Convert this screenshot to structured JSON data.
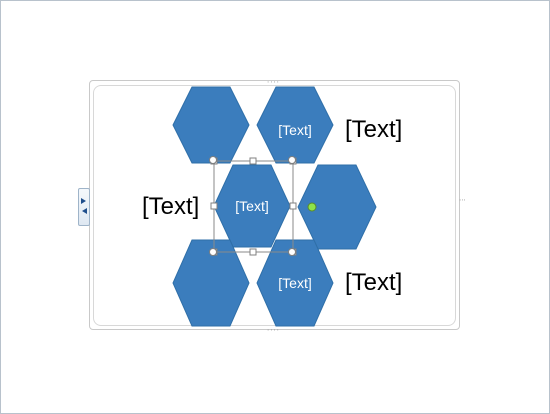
{
  "diagram": {
    "hexagons": [
      {
        "label": ""
      },
      {
        "label": "[Text]"
      },
      {
        "label": "[Text]"
      },
      {
        "label": ""
      },
      {
        "label": ""
      },
      {
        "label": "[Text]"
      }
    ],
    "callouts": {
      "top_right": "[Text]",
      "middle_left": "[Text]",
      "bottom_right": "[Text]"
    },
    "colors": {
      "hex_fill": "#3b7dbd",
      "hex_text": "#ffffff",
      "rotation_handle": "#8ee24a"
    }
  },
  "frame": {
    "handle_dots": "∙∙∙∙",
    "side_dots": "∙∙∙"
  }
}
